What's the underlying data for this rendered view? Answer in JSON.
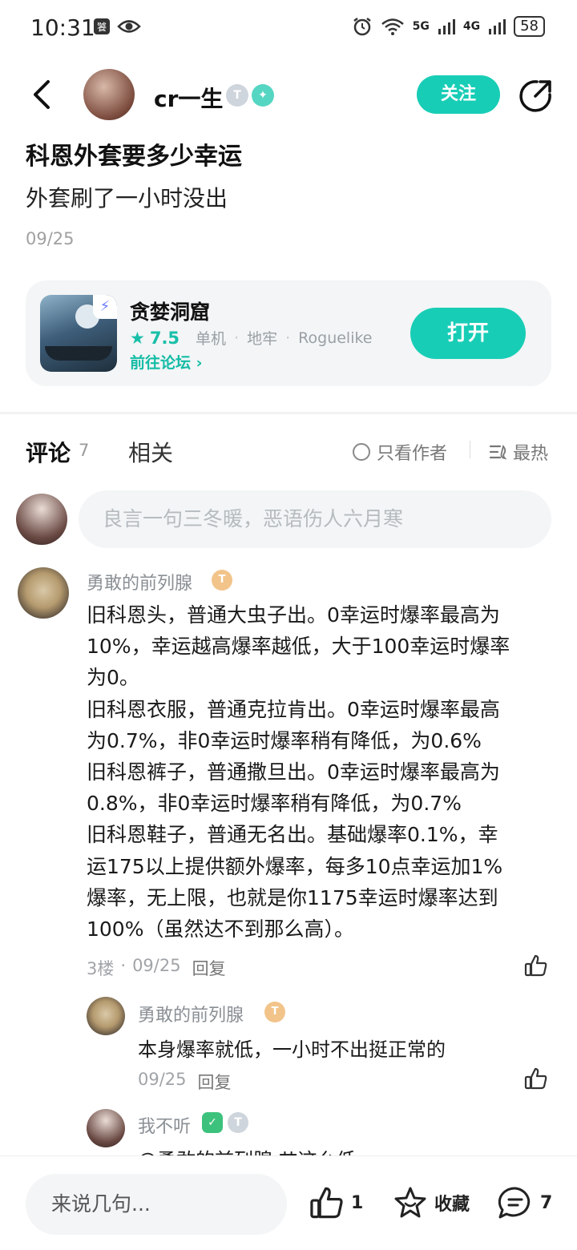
{
  "status_bar": {
    "time": "10:31",
    "network_5g": "5G",
    "network_4g": "4G",
    "battery": "58"
  },
  "header": {
    "author_name": "cr一生",
    "badge_level": "T",
    "follow_label": "关注"
  },
  "post": {
    "title": "科恩外套要多少幸运",
    "body": "外套刷了一小时没出",
    "date": "09/25"
  },
  "game_card": {
    "name": "贪婪洞窟",
    "rating_star": "★",
    "rating": "7.5",
    "tags": [
      "单机",
      "地牢",
      "Roguelike"
    ],
    "forum_link": "前往论坛 ›",
    "open_label": "打开"
  },
  "tabs": {
    "comments_label": "评论",
    "comments_count": "7",
    "related_label": "相关",
    "author_only_label": "只看作者",
    "sort_label": "最热"
  },
  "comment_input": {
    "placeholder": "良言一句三冬暖，恶语伤人六月寒"
  },
  "comments": [
    {
      "author": "勇敢的前列腺",
      "level": "T",
      "lines": [
        "旧科恩头，普通大虫子出。0幸运时爆率最高为",
        "10%，幸运越高爆率越低，大于100幸运时爆率",
        "为0。",
        "旧科恩衣服，普通克拉肯出。0幸运时爆率最高",
        "为0.7%，非0幸运时爆率稍有降低，为0.6%",
        "旧科恩裤子，普通撒旦出。0幸运时爆率最高为",
        "0.8%，非0幸运时爆率稍有降低，为0.7%",
        "旧科恩鞋子，普通无名出。基础爆率0.1%，幸",
        "运175以上提供额外爆率，每多10点幸运加1%",
        "爆率，无上限，也就是你1175幸运时爆率达到",
        "100%（虽然达不到那么高）。"
      ],
      "floor": "3楼",
      "date": "09/25",
      "reply_label": "回复"
    }
  ],
  "replies": [
    {
      "author": "勇敢的前列腺",
      "level": "T",
      "text": "本身爆率就低，一小时不出挺正常的",
      "date": "09/25",
      "reply_label": "回复"
    },
    {
      "author": "我不听",
      "level": "T",
      "text_partial": "@勇敢的前列腺 艹这么低"
    }
  ],
  "bottom_bar": {
    "input_placeholder": "来说几句...",
    "like_count": "1",
    "favorite_label": "收藏",
    "comment_count": "7"
  }
}
